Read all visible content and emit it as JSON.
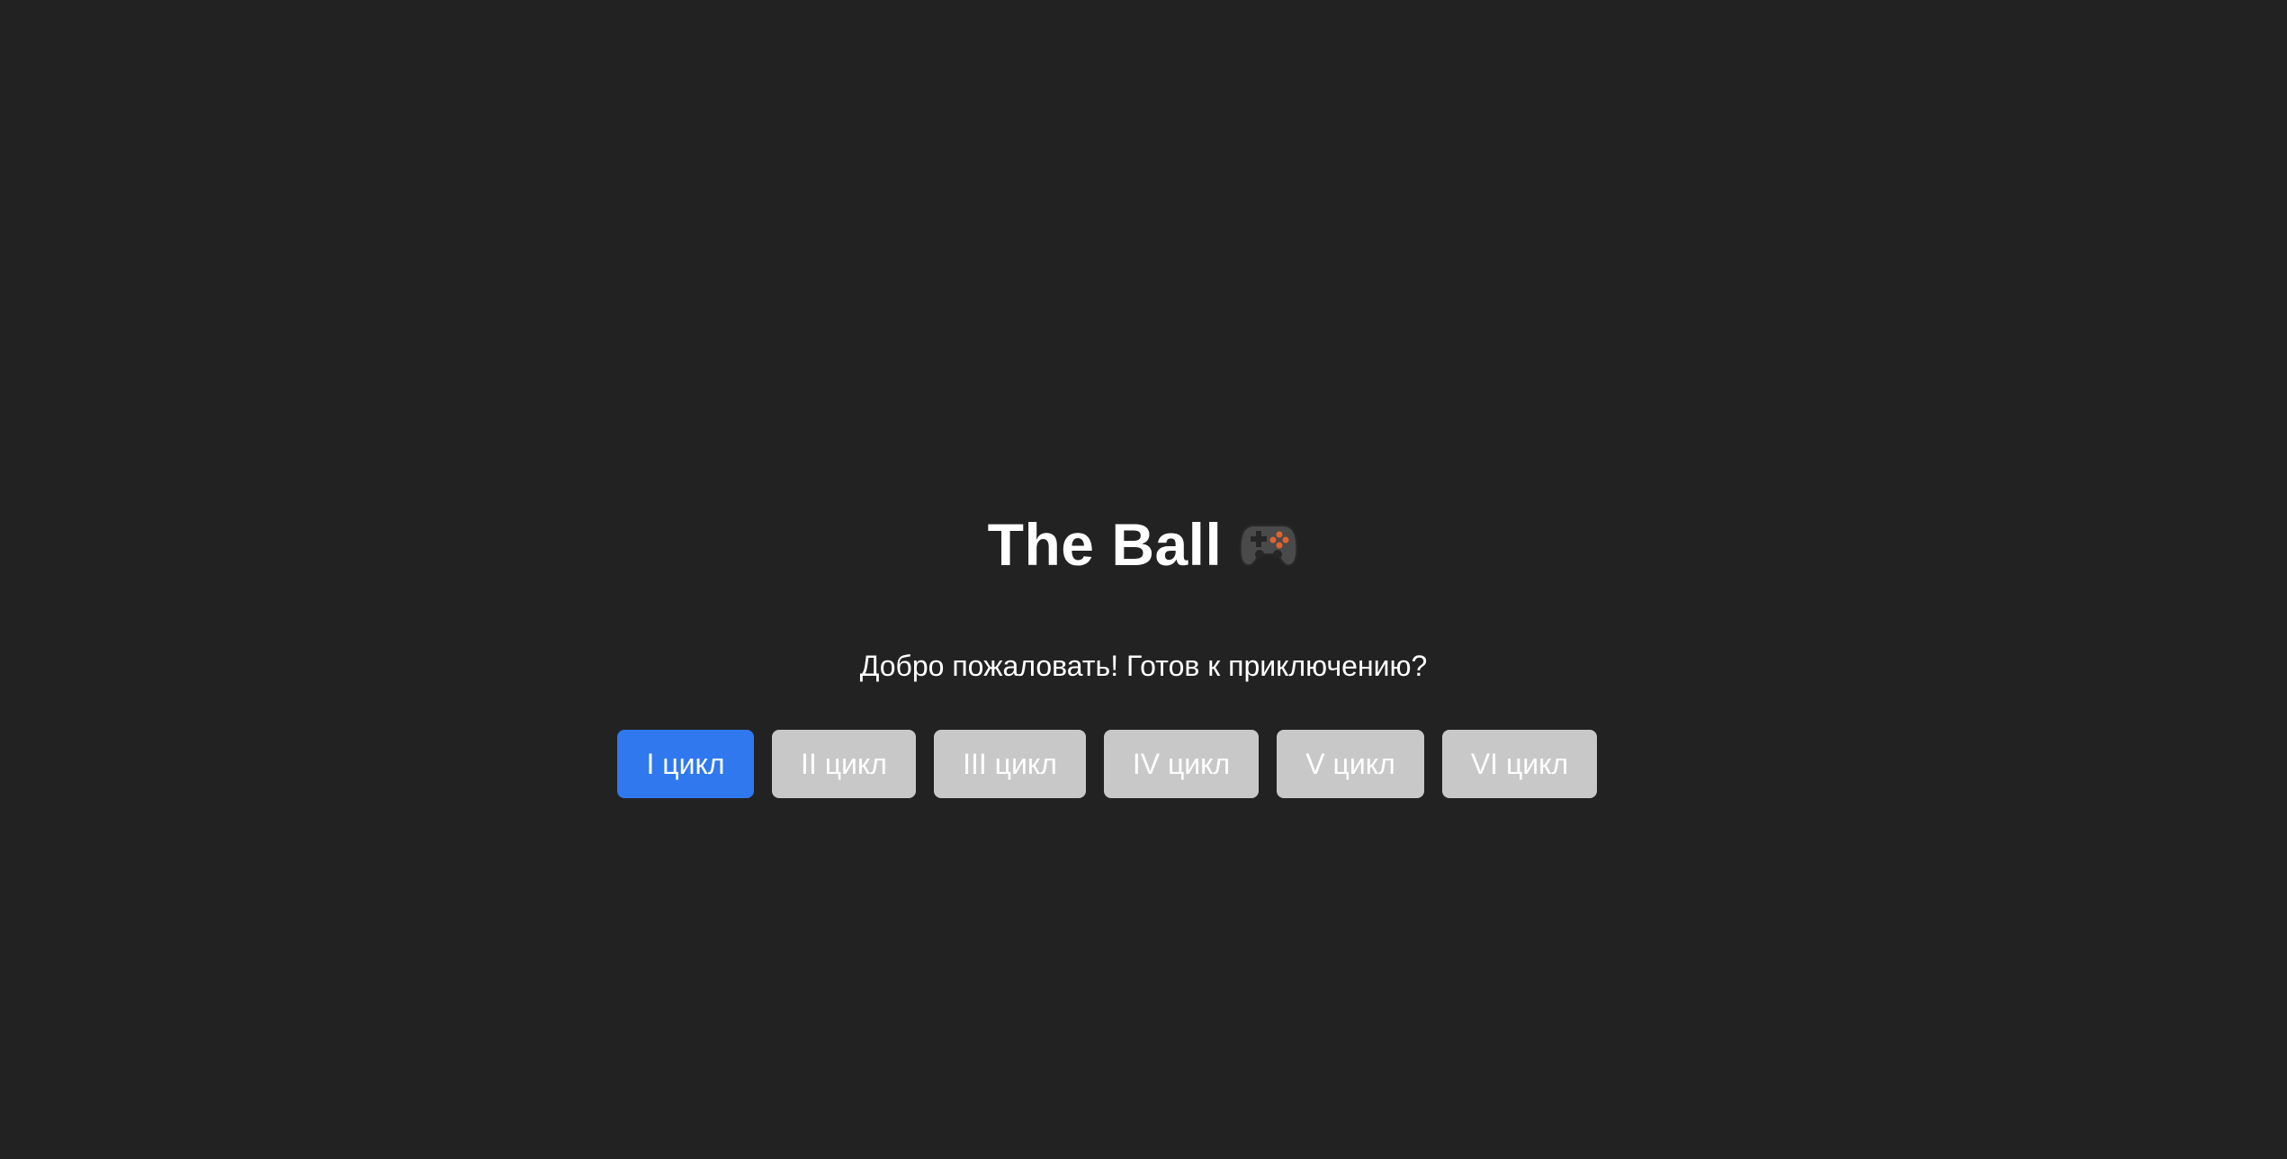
{
  "page": {
    "title": "The Ball",
    "title_icon": "gamepad-icon",
    "subtitle": "Добро пожаловать! Готов к приключению?"
  },
  "cycles": [
    {
      "label": "I цикл",
      "state": "active"
    },
    {
      "label": "II цикл",
      "state": "disabled"
    },
    {
      "label": "III цикл",
      "state": "disabled"
    },
    {
      "label": "IV цикл",
      "state": "disabled"
    },
    {
      "label": "V цикл",
      "state": "disabled"
    },
    {
      "label": "VI цикл",
      "state": "disabled"
    }
  ],
  "colors": {
    "background": "#222222",
    "text": "#ffffff",
    "active_button": "#2f78ee",
    "disabled_button": "#c8c8c8"
  }
}
